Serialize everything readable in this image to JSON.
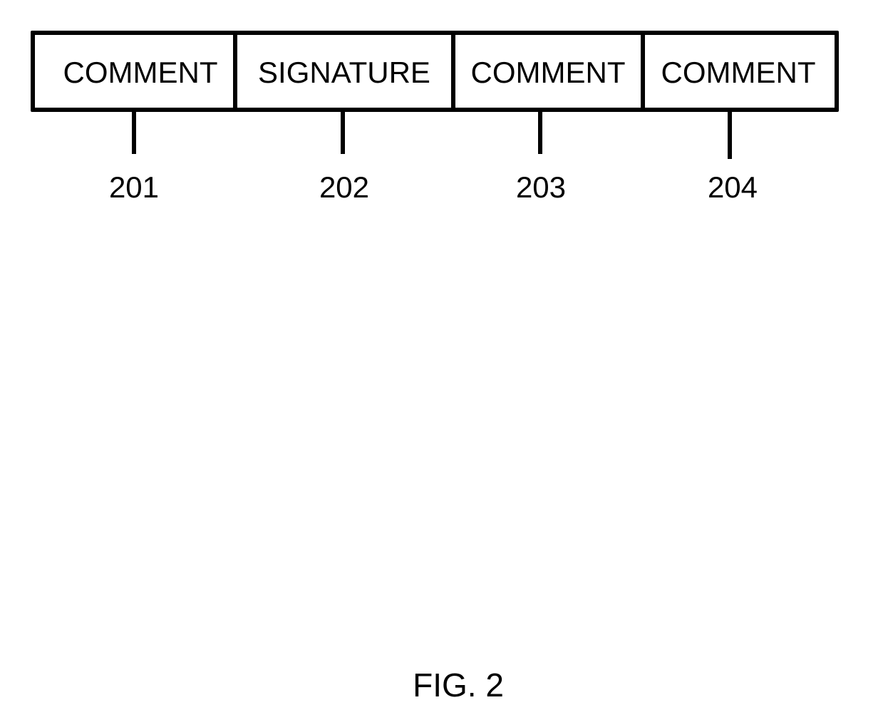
{
  "figure": {
    "caption": "FIG. 2",
    "fields": [
      {
        "label": "COMMENT",
        "ref": "201"
      },
      {
        "label": "SIGNATURE",
        "ref": "202"
      },
      {
        "label": "COMMENT",
        "ref": "203"
      },
      {
        "label": "COMMENT",
        "ref": "204"
      }
    ]
  }
}
